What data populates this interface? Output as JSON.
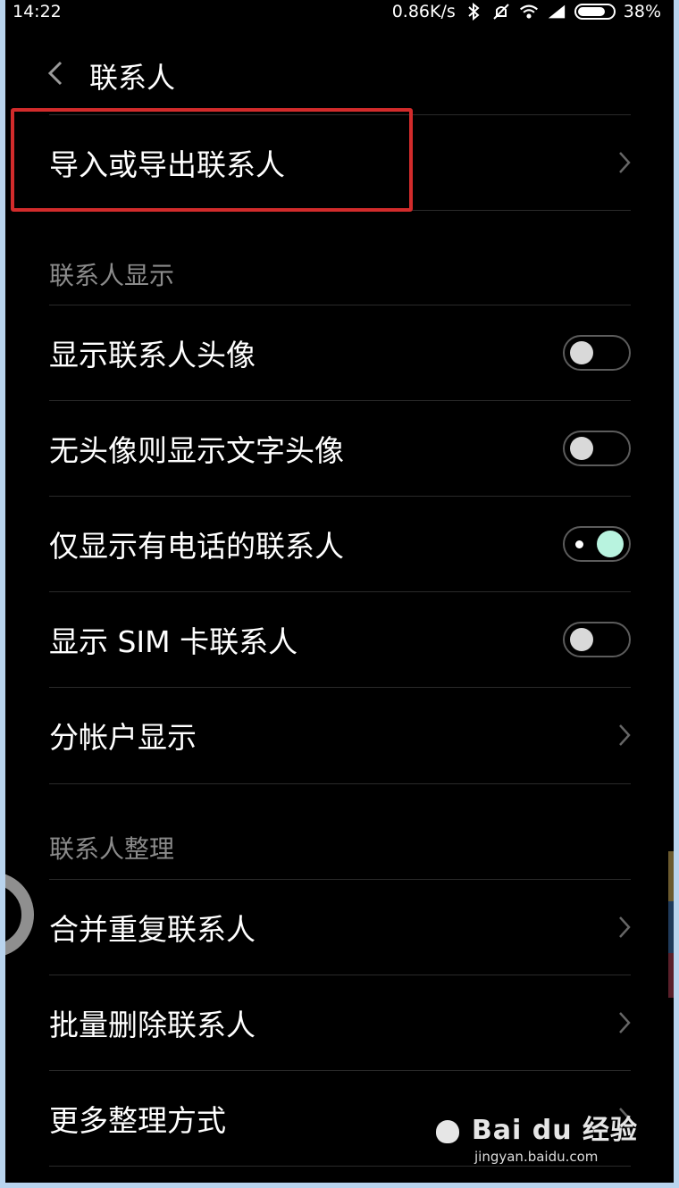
{
  "status_bar": {
    "time": "14:22",
    "network_speed": "0.86K/s",
    "battery": "38%",
    "icons": [
      "bluetooth-icon",
      "mute-icon",
      "wifi-icon",
      "signal-icon",
      "battery-icon"
    ]
  },
  "header": {
    "title": "联系人",
    "back_icon": "chevron-left-icon"
  },
  "top_item": {
    "label": "导入或导出联系人",
    "highlighted": true
  },
  "display_section": {
    "title": "联系人显示",
    "items": [
      {
        "label": "显示联系人头像",
        "control": "toggle",
        "on": false
      },
      {
        "label": "无头像则显示文字头像",
        "control": "toggle",
        "on": false
      },
      {
        "label": "仅显示有电话的联系人",
        "control": "toggle",
        "on": true
      },
      {
        "label": "显示 SIM 卡联系人",
        "control": "toggle",
        "on": false
      },
      {
        "label": "分帐户显示",
        "control": "chevron"
      }
    ]
  },
  "organize_section": {
    "title": "联系人整理",
    "items": [
      {
        "label": "合并重复联系人",
        "control": "chevron"
      },
      {
        "label": "批量删除联系人",
        "control": "chevron"
      },
      {
        "label": "更多整理方式",
        "control": "chevron"
      }
    ]
  },
  "watermark": {
    "brand": "Bai du 经验",
    "url": "jingyan.baidu.com"
  },
  "colors": {
    "background": "#000000",
    "text": "#ffffff",
    "section_title": "#8b8b8b",
    "highlight_box": "#d22b2b",
    "toggle_on": "#b8f3df"
  }
}
